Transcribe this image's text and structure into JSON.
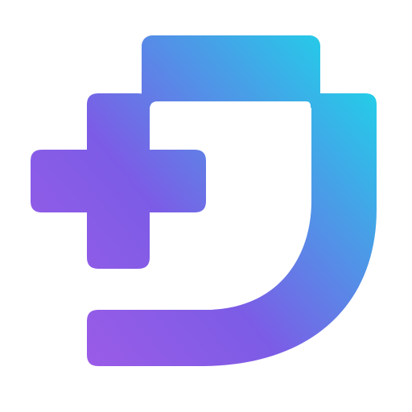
{
  "logo": {
    "icon": "medical-cross-d-letter-logo-icon",
    "colors": {
      "background": "#ffffff",
      "gradient_start": "#A45BE8",
      "gradient_mid": "#7C5CE6",
      "gradient_end": "#22CFE8",
      "inner_cutout": "#ffffff"
    }
  }
}
